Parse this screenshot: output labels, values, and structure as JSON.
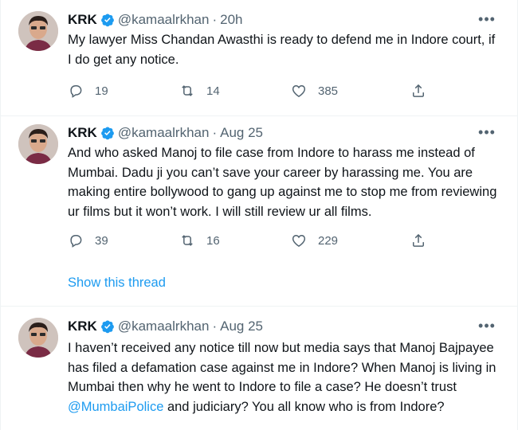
{
  "tweets": [
    {
      "name": "KRK",
      "handle": "@kamaalrkhan",
      "dot": "·",
      "time": "20h",
      "text": "My lawyer Miss Chandan Awasthi is ready to defend me in Indore court, if I do get any notice.",
      "replies": "19",
      "retweets": "14",
      "likes": "385"
    },
    {
      "name": "KRK",
      "handle": "@kamaalrkhan",
      "dot": "·",
      "time": "Aug 25",
      "text": "And who asked Manoj to file case from Indore to harass me instead of Mumbai. Dadu ji you can’t save your career by harassing me. You are making entire bollywood to gang up against me to stop me from reviewing ur films but it won’t work. I will still review ur all films.",
      "replies": "39",
      "retweets": "16",
      "likes": "229",
      "thread_link": "Show this thread"
    },
    {
      "name": "KRK",
      "handle": "@kamaalrkhan",
      "dot": "·",
      "time": "Aug 25",
      "text_before": "I haven’t received any notice till now but media says that Manoj Bajpayee has filed a defamation case against me in Indore? When Manoj is living in Mumbai then why he went to Indore to file a case? He doesn’t trust ",
      "mention": "@MumbaiPolice",
      "text_after": " and judiciary? You all know who is from Indore?"
    }
  ],
  "more_glyph": "•••",
  "colors": {
    "accent": "#1d9bf0",
    "secondary_text": "#536471",
    "primary_text": "#0f1419",
    "divider": "#eff3f4"
  },
  "icons": [
    "reply-icon",
    "retweet-icon",
    "like-icon",
    "share-icon",
    "verified-badge-icon",
    "more-icon"
  ]
}
